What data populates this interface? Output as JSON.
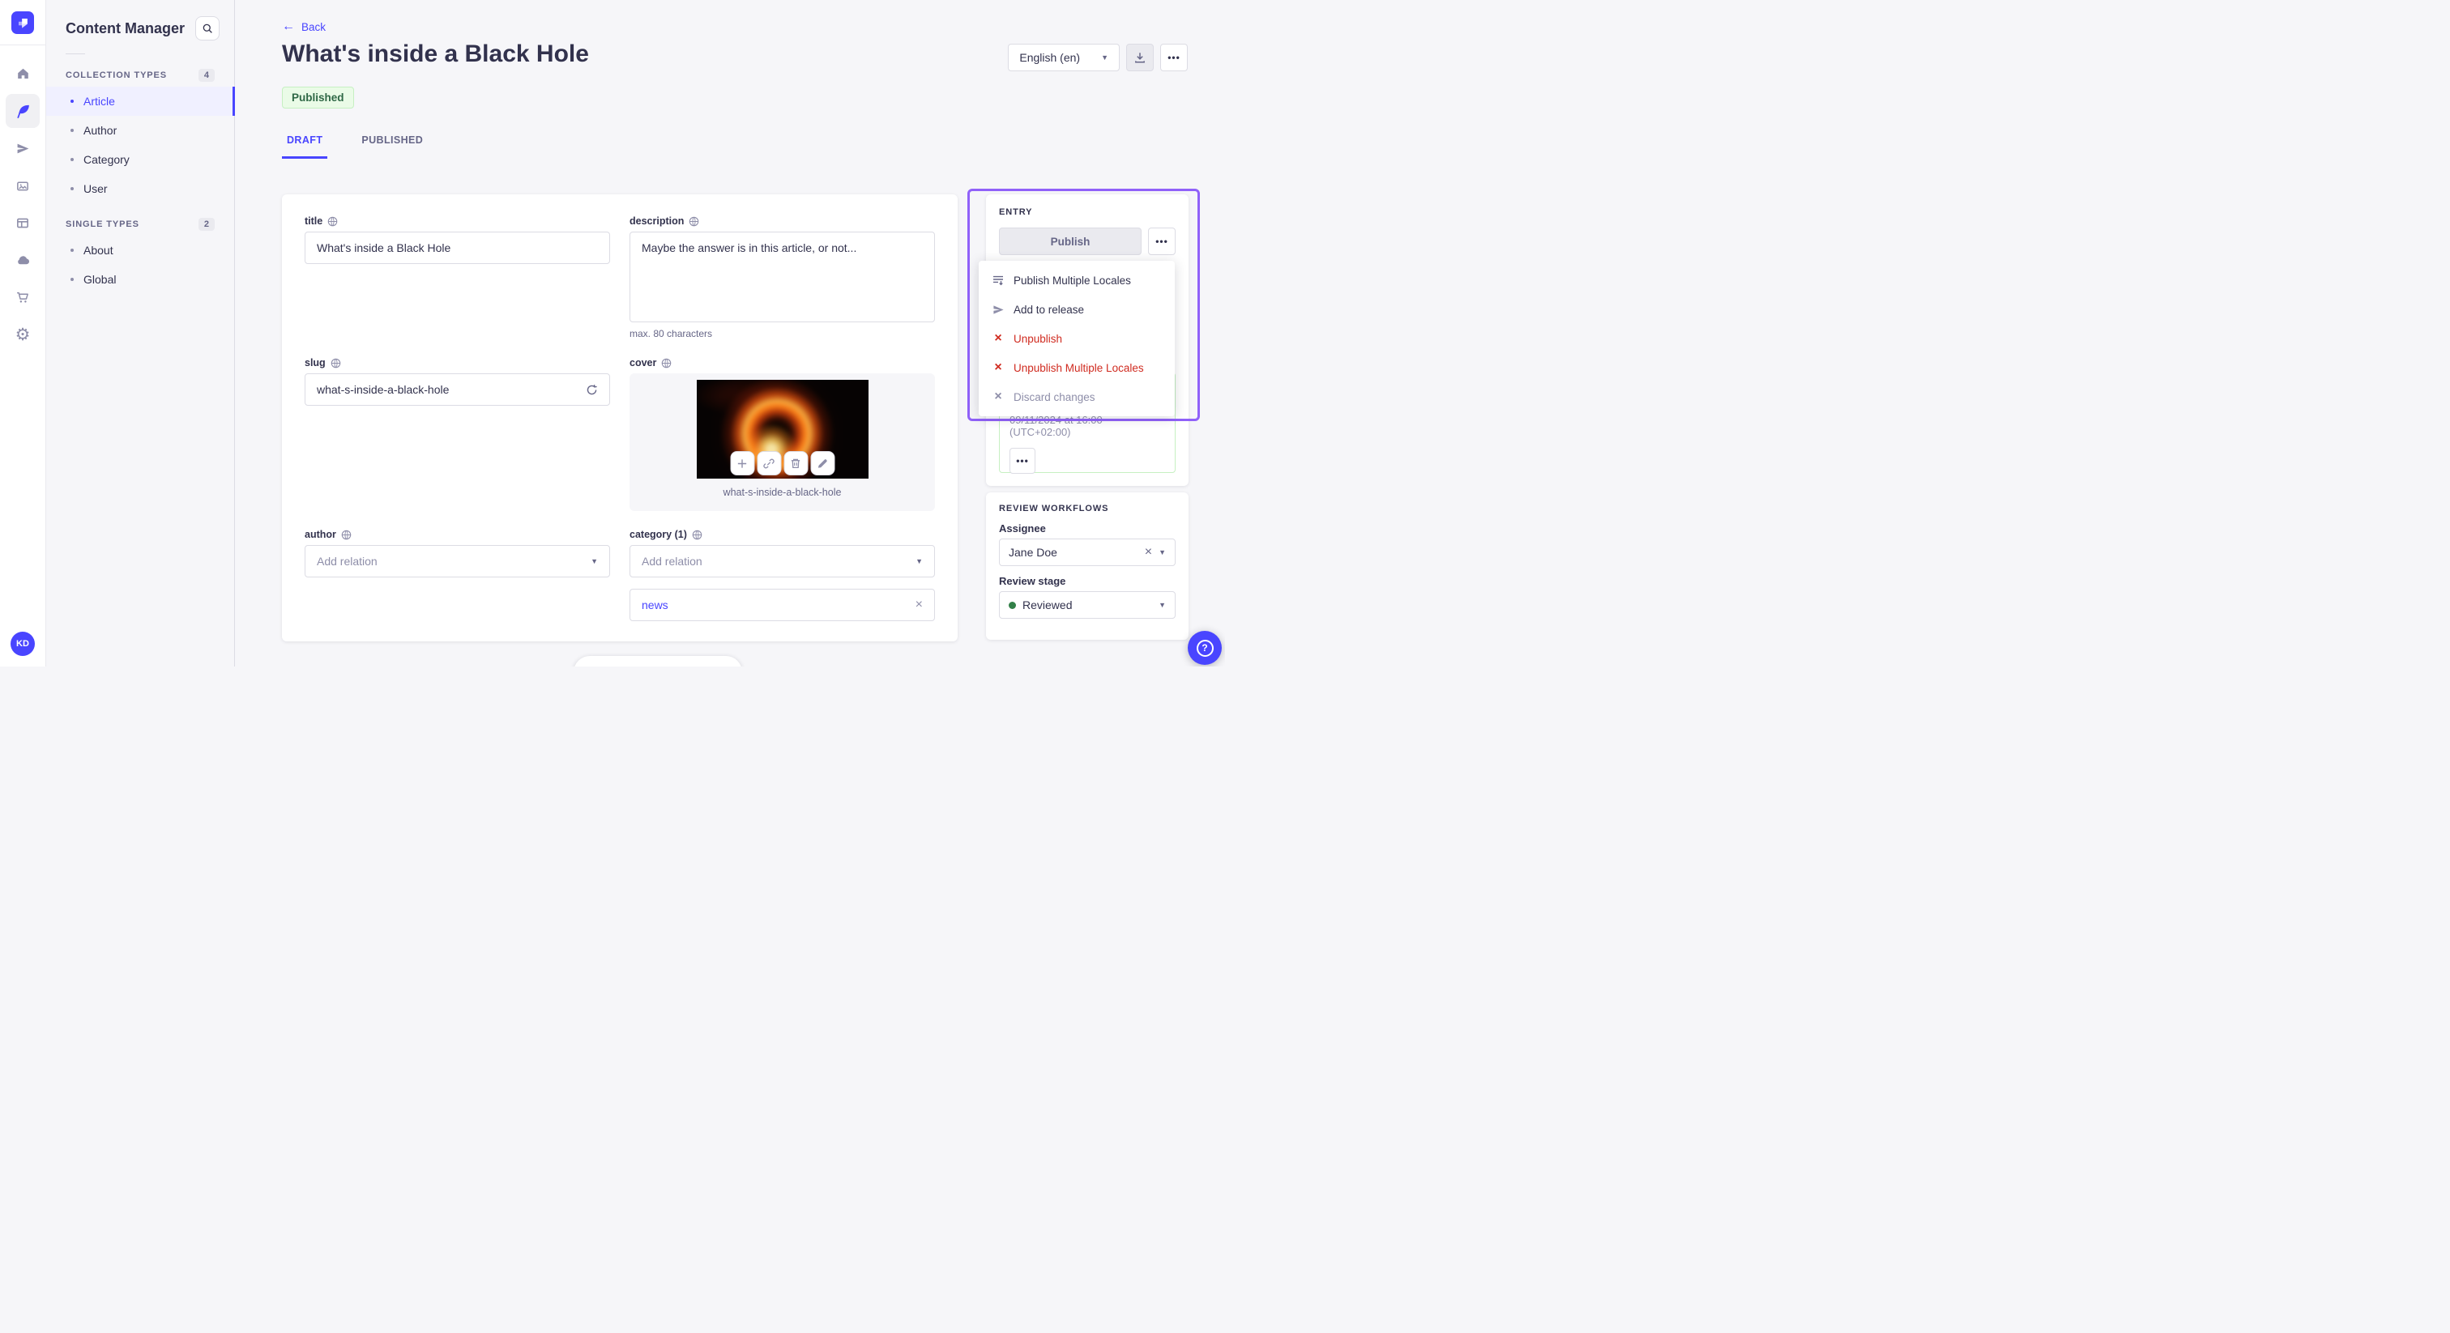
{
  "colors": {
    "accent": "#4945ff",
    "highlight_border": "#9061f9",
    "success_text": "#2f6846",
    "success_bg": "#eafbe7",
    "danger": "#d02b20",
    "page_bg": "#f6f6f9"
  },
  "rail": {
    "avatar_initials": "KD",
    "icons": [
      "strapi-logo",
      "home",
      "content-manager",
      "releases",
      "media-library",
      "layout",
      "cloud",
      "marketplace",
      "settings"
    ]
  },
  "sidebar": {
    "title": "Content Manager",
    "sections": [
      {
        "label": "COLLECTION TYPES",
        "count": "4",
        "items": [
          {
            "label": "Article",
            "active": true
          },
          {
            "label": "Author",
            "active": false
          },
          {
            "label": "Category",
            "active": false
          },
          {
            "label": "User",
            "active": false
          }
        ]
      },
      {
        "label": "SINGLE TYPES",
        "count": "2",
        "items": [
          {
            "label": "About",
            "active": false
          },
          {
            "label": "Global",
            "active": false
          }
        ]
      }
    ]
  },
  "header": {
    "back_label": "Back",
    "title": "What's inside a Black Hole",
    "status_badge": "Published",
    "locale_selected": "English (en)",
    "tabs": [
      {
        "label": "DRAFT",
        "active": true
      },
      {
        "label": "PUBLISHED",
        "active": false
      }
    ]
  },
  "form": {
    "title": {
      "label": "title",
      "value": "What's inside a Black Hole"
    },
    "description": {
      "label": "description",
      "value": "Maybe the answer is in this article, or not...",
      "helper": "max. 80 characters"
    },
    "slug": {
      "label": "slug",
      "value": "what-s-inside-a-black-hole"
    },
    "cover": {
      "label": "cover",
      "caption": "what-s-inside-a-black-hole"
    },
    "author": {
      "label": "author",
      "placeholder": "Add relation"
    },
    "category": {
      "label": "category (1)",
      "placeholder": "Add relation",
      "selected": "news"
    }
  },
  "entry_panel": {
    "section_label": "ENTRY",
    "publish_label": "Publish",
    "scheduled_date": "09/11/2024 at 16:00 (UTC+02:00)"
  },
  "entry_menu": {
    "items": [
      {
        "label": "Publish Multiple Locales",
        "style": "default",
        "icon": "list-arrow"
      },
      {
        "label": "Add to release",
        "style": "default",
        "icon": "paper-plane"
      },
      {
        "label": "Unpublish",
        "style": "danger",
        "icon": "cross"
      },
      {
        "label": "Unpublish Multiple Locales",
        "style": "danger",
        "icon": "cross"
      },
      {
        "label": "Discard changes",
        "style": "disabled",
        "icon": "cross"
      }
    ]
  },
  "review_panel": {
    "section_label": "REVIEW WORKFLOWS",
    "assignee_label": "Assignee",
    "assignee_value": "Jane Doe",
    "stage_label": "Review stage",
    "stage_value": "Reviewed"
  }
}
